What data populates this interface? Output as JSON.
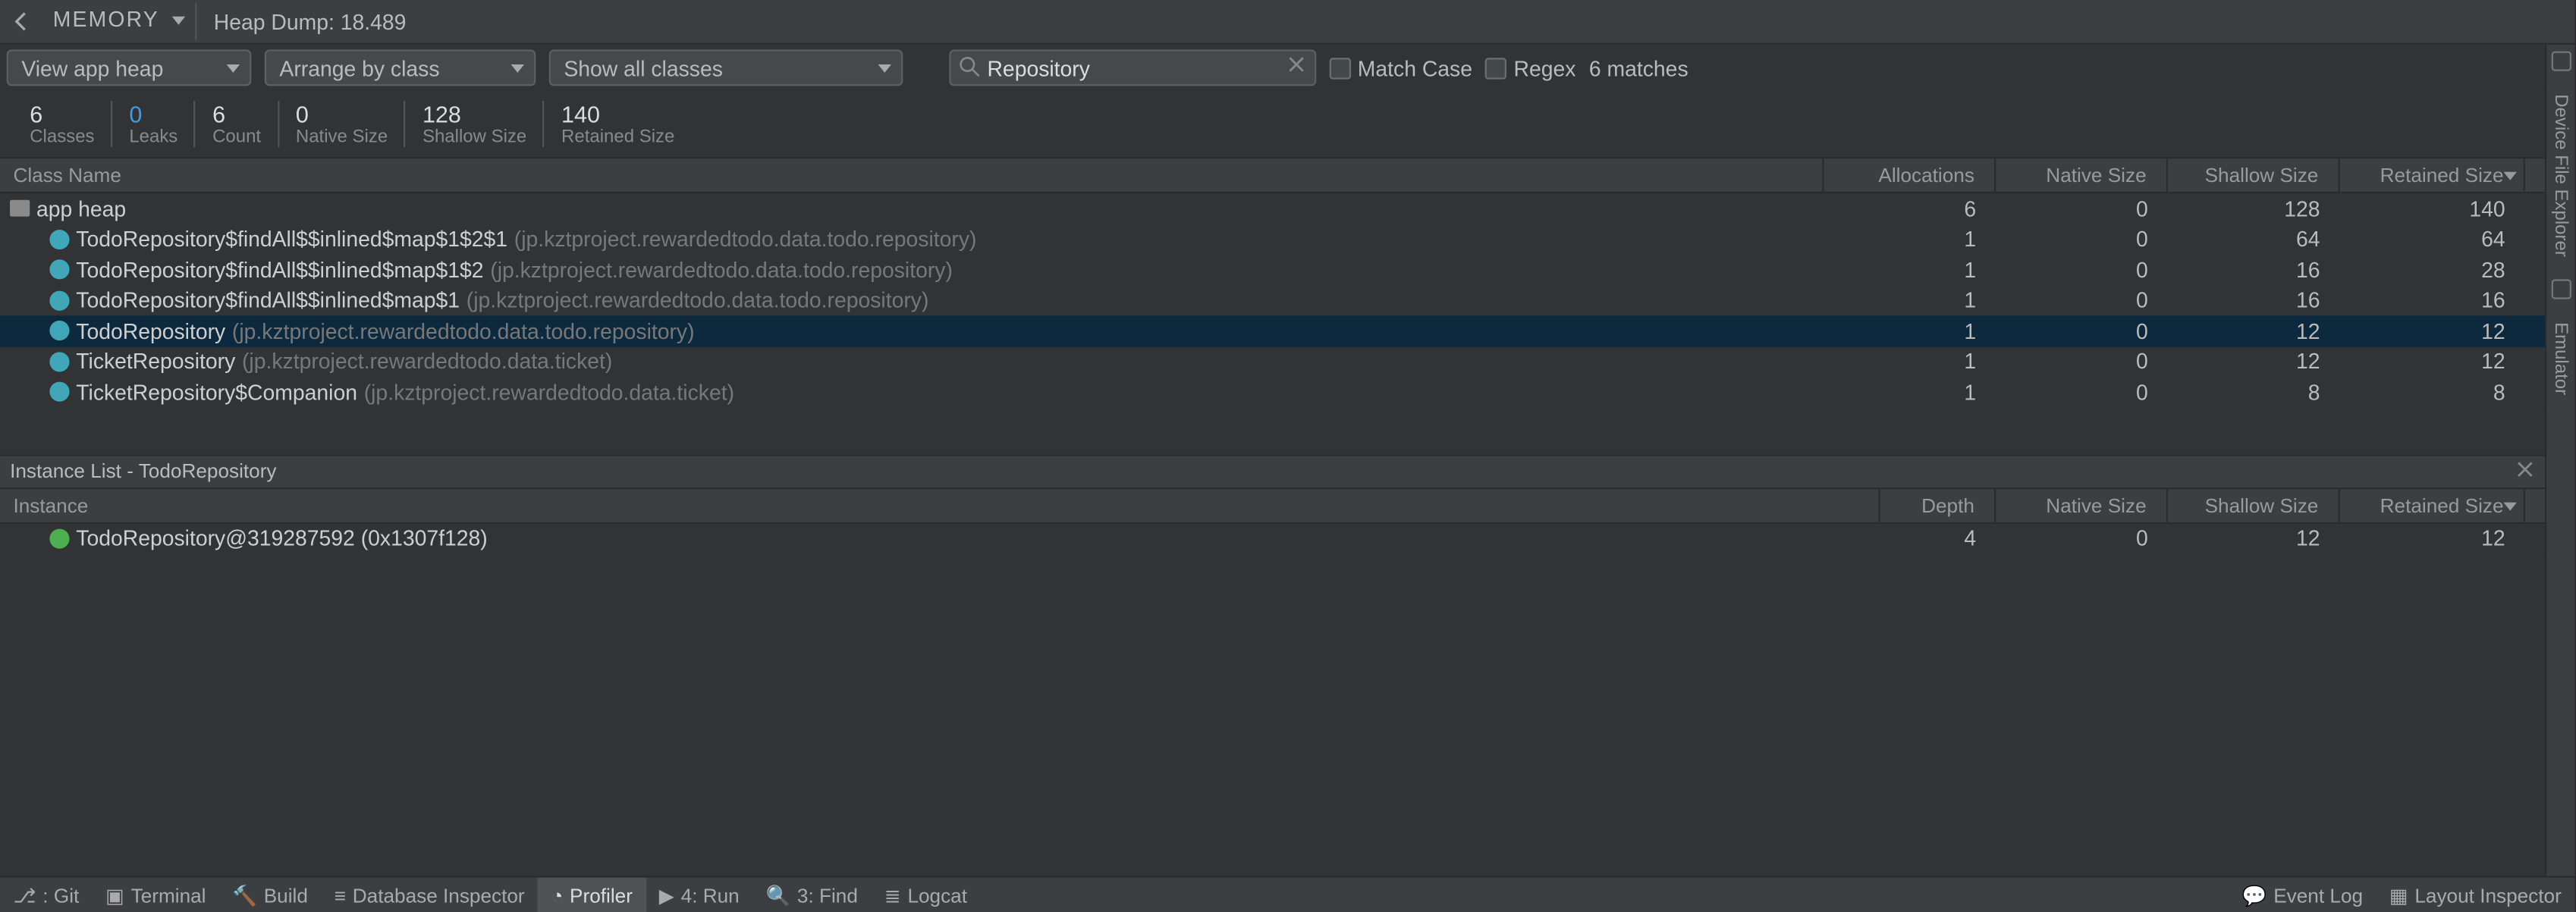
{
  "topbar": {
    "memory_dropdown": "MEMORY",
    "heap_dump_label": "Heap Dump: 18.489"
  },
  "filters": {
    "view_heap": "View app heap",
    "arrange": "Arrange by class",
    "show_classes": "Show all classes",
    "search_value": "Repository",
    "match_case": "Match Case",
    "regex": "Regex",
    "match_count": "6 matches"
  },
  "stats": {
    "classes_v": "6",
    "classes_l": "Classes",
    "leaks_v": "0",
    "leaks_l": "Leaks",
    "count_v": "6",
    "count_l": "Count",
    "native_v": "0",
    "native_l": "Native Size",
    "shallow_v": "128",
    "shallow_l": "Shallow Size",
    "retained_v": "140",
    "retained_l": "Retained Size"
  },
  "class_table": {
    "hdr_name": "Class Name",
    "hdr_alloc": "Allocations",
    "hdr_native": "Native Size",
    "hdr_shallow": "Shallow Size",
    "hdr_retained": "Retained Size",
    "rows": [
      {
        "name": "app heap",
        "pkg": "",
        "alloc": "6",
        "native": "0",
        "shallow": "128",
        "retained": "140",
        "icon": "folder",
        "indent": 0,
        "sel": false,
        "s_bar": 0,
        "r_bar": 0
      },
      {
        "name": "TodoRepository$findAll$$inlined$map$1$2$1",
        "pkg": " (jp.kztproject.rewardedtodo.data.todo.repository)",
        "alloc": "1",
        "native": "0",
        "shallow": "64",
        "retained": "64",
        "icon": "class",
        "indent": 1,
        "sel": false,
        "s_bar": 52,
        "r_bar": 46
      },
      {
        "name": "TodoRepository$findAll$$inlined$map$1$2",
        "pkg": " (jp.kztproject.rewardedtodo.data.todo.repository)",
        "alloc": "1",
        "native": "0",
        "shallow": "16",
        "retained": "28",
        "icon": "class",
        "indent": 1,
        "sel": false,
        "s_bar": 16,
        "r_bar": 22
      },
      {
        "name": "TodoRepository$findAll$$inlined$map$1",
        "pkg": " (jp.kztproject.rewardedtodo.data.todo.repository)",
        "alloc": "1",
        "native": "0",
        "shallow": "16",
        "retained": "16",
        "icon": "class",
        "indent": 1,
        "sel": false,
        "s_bar": 16,
        "r_bar": 14
      },
      {
        "name": "TodoRepository",
        "pkg": " (jp.kztproject.rewardedtodo.data.todo.repository)",
        "alloc": "1",
        "native": "0",
        "shallow": "12",
        "retained": "12",
        "icon": "class",
        "indent": 1,
        "sel": true,
        "s_bar": 14,
        "r_bar": 12
      },
      {
        "name": "TicketRepository",
        "pkg": " (jp.kztproject.rewardedtodo.data.ticket)",
        "alloc": "1",
        "native": "0",
        "shallow": "12",
        "retained": "12",
        "icon": "class",
        "indent": 1,
        "sel": false,
        "s_bar": 14,
        "r_bar": 12
      },
      {
        "name": "TicketRepository$Companion",
        "pkg": " (jp.kztproject.rewardedtodo.data.ticket)",
        "alloc": "1",
        "native": "0",
        "shallow": "8",
        "retained": "8",
        "icon": "class",
        "indent": 1,
        "sel": false,
        "s_bar": 10,
        "r_bar": 9
      }
    ]
  },
  "instance_section": {
    "title": "Instance List - TodoRepository",
    "hdr_instance": "Instance",
    "hdr_depth": "Depth",
    "hdr_native": "Native Size",
    "hdr_shallow": "Shallow Size",
    "hdr_retained": "Retained Size",
    "rows": [
      {
        "name": "TodoRepository@319287592 (0x1307f128)",
        "depth": "4",
        "native": "0",
        "shallow": "12",
        "retained": "12"
      }
    ]
  },
  "toolstrip": {
    "git": ": Git",
    "terminal": "Terminal",
    "build": "Build",
    "dbinspect": "Database Inspector",
    "profiler": "Profiler",
    "run": "4: Run",
    "find": "3: Find",
    "logcat": "Logcat",
    "eventlog": "Event Log",
    "layoutinsp": "Layout Inspector"
  },
  "right_rail": {
    "device_explorer": "Device File Explorer",
    "emulator": "Emulator"
  }
}
